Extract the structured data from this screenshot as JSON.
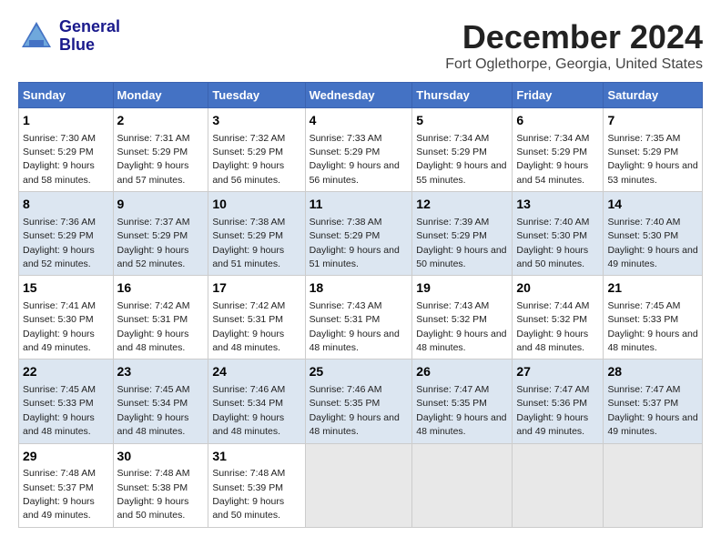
{
  "logo": {
    "line1": "General",
    "line2": "Blue"
  },
  "title": "December 2024",
  "subtitle": "Fort Oglethorpe, Georgia, United States",
  "headers": [
    "Sunday",
    "Monday",
    "Tuesday",
    "Wednesday",
    "Thursday",
    "Friday",
    "Saturday"
  ],
  "weeks": [
    [
      {
        "day": "1",
        "sunrise": "7:30 AM",
        "sunset": "5:29 PM",
        "daylight": "9 hours and 58 minutes."
      },
      {
        "day": "2",
        "sunrise": "7:31 AM",
        "sunset": "5:29 PM",
        "daylight": "9 hours and 57 minutes."
      },
      {
        "day": "3",
        "sunrise": "7:32 AM",
        "sunset": "5:29 PM",
        "daylight": "9 hours and 56 minutes."
      },
      {
        "day": "4",
        "sunrise": "7:33 AM",
        "sunset": "5:29 PM",
        "daylight": "9 hours and 56 minutes."
      },
      {
        "day": "5",
        "sunrise": "7:34 AM",
        "sunset": "5:29 PM",
        "daylight": "9 hours and 55 minutes."
      },
      {
        "day": "6",
        "sunrise": "7:34 AM",
        "sunset": "5:29 PM",
        "daylight": "9 hours and 54 minutes."
      },
      {
        "day": "7",
        "sunrise": "7:35 AM",
        "sunset": "5:29 PM",
        "daylight": "9 hours and 53 minutes."
      }
    ],
    [
      {
        "day": "8",
        "sunrise": "7:36 AM",
        "sunset": "5:29 PM",
        "daylight": "9 hours and 52 minutes."
      },
      {
        "day": "9",
        "sunrise": "7:37 AM",
        "sunset": "5:29 PM",
        "daylight": "9 hours and 52 minutes."
      },
      {
        "day": "10",
        "sunrise": "7:38 AM",
        "sunset": "5:29 PM",
        "daylight": "9 hours and 51 minutes."
      },
      {
        "day": "11",
        "sunrise": "7:38 AM",
        "sunset": "5:29 PM",
        "daylight": "9 hours and 51 minutes."
      },
      {
        "day": "12",
        "sunrise": "7:39 AM",
        "sunset": "5:29 PM",
        "daylight": "9 hours and 50 minutes."
      },
      {
        "day": "13",
        "sunrise": "7:40 AM",
        "sunset": "5:30 PM",
        "daylight": "9 hours and 50 minutes."
      },
      {
        "day": "14",
        "sunrise": "7:40 AM",
        "sunset": "5:30 PM",
        "daylight": "9 hours and 49 minutes."
      }
    ],
    [
      {
        "day": "15",
        "sunrise": "7:41 AM",
        "sunset": "5:30 PM",
        "daylight": "9 hours and 49 minutes."
      },
      {
        "day": "16",
        "sunrise": "7:42 AM",
        "sunset": "5:31 PM",
        "daylight": "9 hours and 48 minutes."
      },
      {
        "day": "17",
        "sunrise": "7:42 AM",
        "sunset": "5:31 PM",
        "daylight": "9 hours and 48 minutes."
      },
      {
        "day": "18",
        "sunrise": "7:43 AM",
        "sunset": "5:31 PM",
        "daylight": "9 hours and 48 minutes."
      },
      {
        "day": "19",
        "sunrise": "7:43 AM",
        "sunset": "5:32 PM",
        "daylight": "9 hours and 48 minutes."
      },
      {
        "day": "20",
        "sunrise": "7:44 AM",
        "sunset": "5:32 PM",
        "daylight": "9 hours and 48 minutes."
      },
      {
        "day": "21",
        "sunrise": "7:45 AM",
        "sunset": "5:33 PM",
        "daylight": "9 hours and 48 minutes."
      }
    ],
    [
      {
        "day": "22",
        "sunrise": "7:45 AM",
        "sunset": "5:33 PM",
        "daylight": "9 hours and 48 minutes."
      },
      {
        "day": "23",
        "sunrise": "7:45 AM",
        "sunset": "5:34 PM",
        "daylight": "9 hours and 48 minutes."
      },
      {
        "day": "24",
        "sunrise": "7:46 AM",
        "sunset": "5:34 PM",
        "daylight": "9 hours and 48 minutes."
      },
      {
        "day": "25",
        "sunrise": "7:46 AM",
        "sunset": "5:35 PM",
        "daylight": "9 hours and 48 minutes."
      },
      {
        "day": "26",
        "sunrise": "7:47 AM",
        "sunset": "5:35 PM",
        "daylight": "9 hours and 48 minutes."
      },
      {
        "day": "27",
        "sunrise": "7:47 AM",
        "sunset": "5:36 PM",
        "daylight": "9 hours and 49 minutes."
      },
      {
        "day": "28",
        "sunrise": "7:47 AM",
        "sunset": "5:37 PM",
        "daylight": "9 hours and 49 minutes."
      }
    ],
    [
      {
        "day": "29",
        "sunrise": "7:48 AM",
        "sunset": "5:37 PM",
        "daylight": "9 hours and 49 minutes."
      },
      {
        "day": "30",
        "sunrise": "7:48 AM",
        "sunset": "5:38 PM",
        "daylight": "9 hours and 50 minutes."
      },
      {
        "day": "31",
        "sunrise": "7:48 AM",
        "sunset": "5:39 PM",
        "daylight": "9 hours and 50 minutes."
      },
      null,
      null,
      null,
      null
    ]
  ],
  "labels": {
    "sunrise": "Sunrise:",
    "sunset": "Sunset:",
    "daylight": "Daylight:"
  }
}
